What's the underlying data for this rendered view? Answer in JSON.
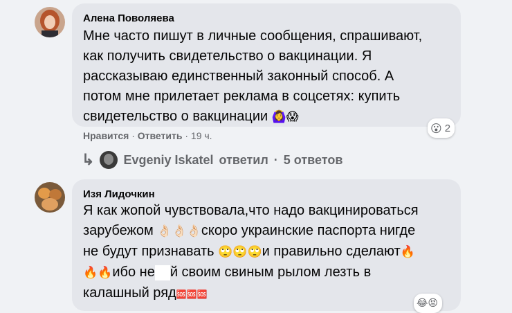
{
  "comment1": {
    "author": "Алена Поволяева",
    "lines": [
      "Мне часто пишут в личные сообщения, спрашивают,",
      "как получить свидетельство о вакцинации. Я",
      "рассказываю единственный законный способ. А",
      "потом мне прилетает реклама в соцсетях: купить",
      "свидетельство о вакцинации"
    ],
    "line_emojis": "🙆‍♀️😱",
    "like_label": "Нравится",
    "reply_label": "Ответить",
    "time": "19 ч.",
    "sep": "·",
    "reaction_icon": "wow-emoji",
    "reaction_glyph": "😮",
    "reaction_count": "2"
  },
  "reply_thread": {
    "arrow_glyph": "↳",
    "author": "Evgeniy Iskatel",
    "action": "ответил",
    "sep": "·",
    "count": "5 ответов"
  },
  "comment2": {
    "author": "Изя Лидочкин",
    "line1": "Я как жопой чувствовала,что надо вакцинироваться",
    "line2_a": "зарубежом",
    "line2_emojis": "👌🏻👌🏻👌🏻",
    "line2_b": "скоро украинские паспорта нигде",
    "line3_a": "не будут признавать",
    "line3_emojis": "🙄🙄🙄",
    "line3_b": "и правильно сделают",
    "line3_fire": "🔥",
    "line4_fire": "🔥🔥",
    "line4_a": "ибо не",
    "line4_b": "й своим свиным рылом лезть в",
    "line5_a": "калашный ряд",
    "line5_sos": "🆘🆘🆘",
    "reaction_glyphs": "😂😡"
  }
}
